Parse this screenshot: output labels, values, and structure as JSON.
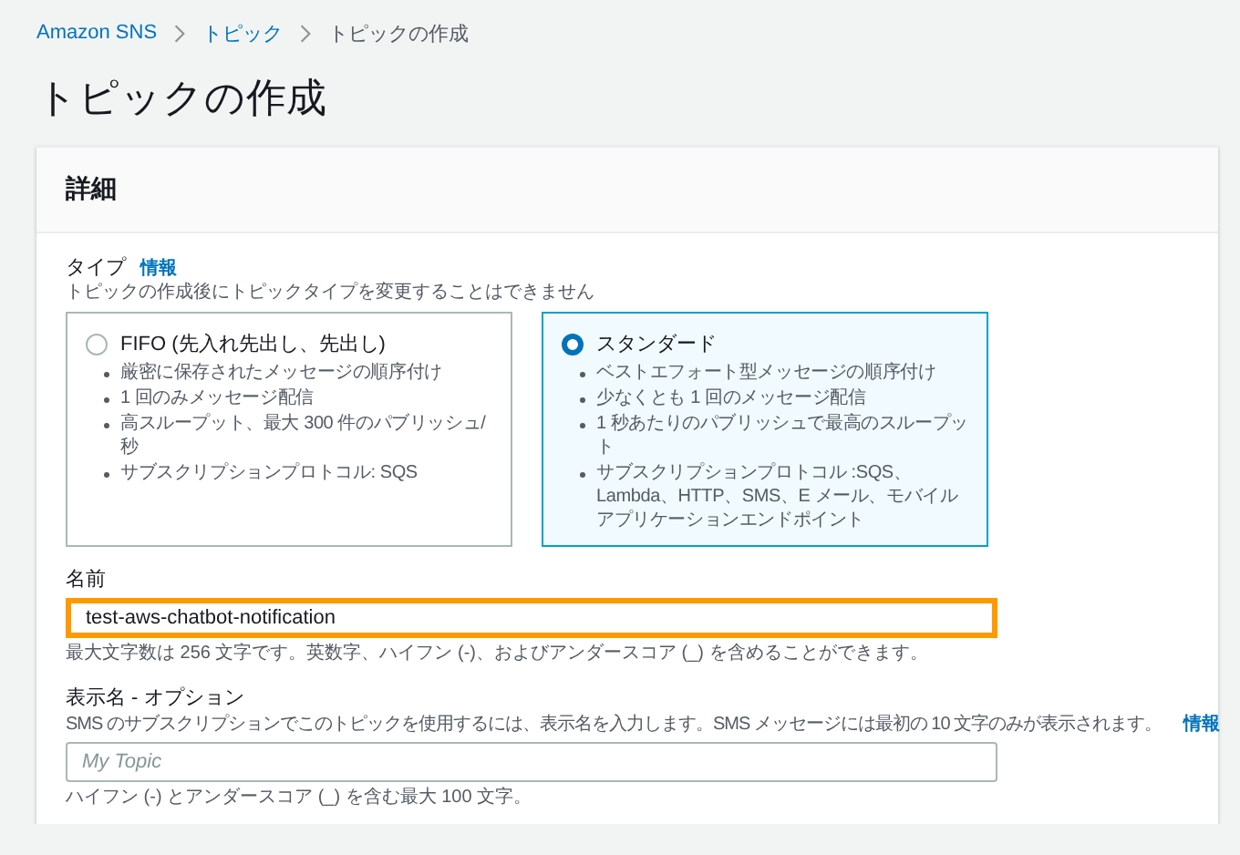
{
  "breadcrumbs": [
    {
      "label": "Amazon SNS",
      "link": true
    },
    {
      "label": "トピック",
      "link": true
    },
    {
      "label": "トピックの作成",
      "link": false
    }
  ],
  "page_title": "トピックの作成",
  "panel": {
    "title": "詳細",
    "type_field": {
      "label": "タイプ",
      "info": "情報",
      "description": "トピックの作成後にトピックタイプを変更することはできません",
      "options": [
        {
          "title": "FIFO (先入れ先出し、先出し)",
          "selected": false,
          "features": [
            "厳密に保存されたメッセージの順序付け",
            "1 回のみメッセージ配信",
            "高スループット、最大 300 件のパブリッシュ/秒",
            "サブスクリプションプロトコル: SQS"
          ]
        },
        {
          "title": "スタンダード",
          "selected": true,
          "features": [
            "ベストエフォート型メッセージの順序付け",
            "少なくとも 1 回のメッセージ配信",
            "1 秒あたりのパブリッシュで最高のスループット",
            "サブスクリプションプロトコル :SQS、Lambda、HTTP、SMS、E メール、モバイルアプリケーションエンドポイント"
          ]
        }
      ]
    },
    "name_field": {
      "label": "名前",
      "value": "test-aws-chatbot-notification",
      "focused": true,
      "hint": "最大文字数は 256 文字です。英数字、ハイフン (-)、およびアンダースコア (_) を含めることができます。"
    },
    "display_name_field": {
      "label": "表示名 - オプション",
      "description": "SMS のサブスクリプションでこのトピックを使用するには、表示名を入力します。SMS メッセージには最初の 10 文字のみが表示されます。",
      "info": "情報",
      "placeholder": "My Topic",
      "focused": false,
      "hint": "ハイフン (-) とアンダースコア (_) を含む最大 100 文字。"
    }
  }
}
